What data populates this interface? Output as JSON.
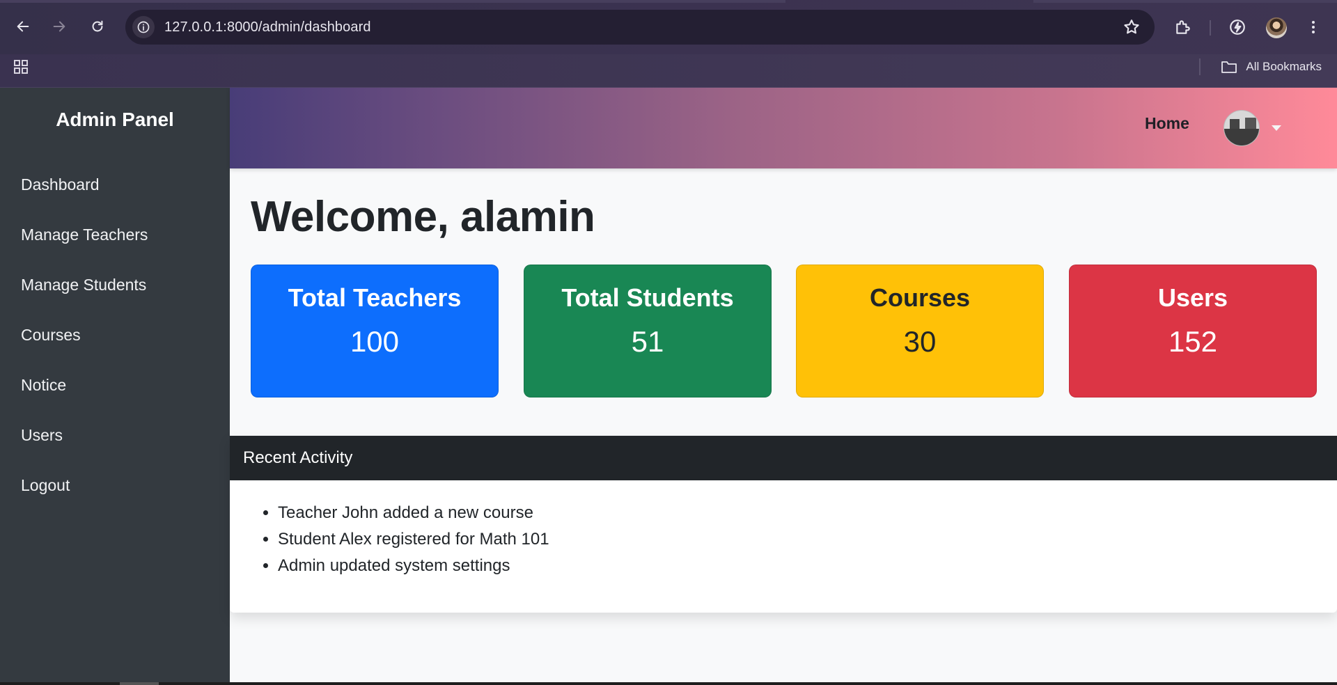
{
  "browser": {
    "url": "127.0.0.1:8000/admin/dashboard",
    "bookmarks_label": "All Bookmarks"
  },
  "sidebar": {
    "brand": "Admin Panel",
    "items": [
      {
        "label": "Dashboard"
      },
      {
        "label": "Manage Teachers"
      },
      {
        "label": "Manage Students"
      },
      {
        "label": "Courses"
      },
      {
        "label": "Notice"
      },
      {
        "label": "Users"
      },
      {
        "label": "Logout"
      }
    ]
  },
  "topbar": {
    "home_label": "Home"
  },
  "main": {
    "welcome": "Welcome, alamin",
    "stats": [
      {
        "title": "Total Teachers",
        "value": "100",
        "color": "#0d6efd",
        "text_color": "#ffffff"
      },
      {
        "title": "Total Students",
        "value": "51",
        "color": "#198754",
        "text_color": "#ffffff"
      },
      {
        "title": "Courses",
        "value": "30",
        "color": "#ffc107",
        "text_color": "#212529"
      },
      {
        "title": "Users",
        "value": "152",
        "color": "#dc3545",
        "text_color": "#ffffff"
      }
    ],
    "activity": {
      "title": "Recent Activity",
      "items": [
        "Teacher John added a new course",
        "Student Alex registered for Math 101",
        "Admin updated system settings"
      ]
    }
  },
  "icons": {
    "back": "arrow-left-icon",
    "forward": "arrow-right-icon",
    "reload": "reload-icon",
    "site_info": "info-icon",
    "bookmark_star": "star-icon",
    "extensions": "puzzle-icon",
    "performance": "lightning-icon",
    "menu": "kebab-menu-icon",
    "apps": "apps-grid-icon",
    "bookmarks_folder": "folder-icon"
  }
}
